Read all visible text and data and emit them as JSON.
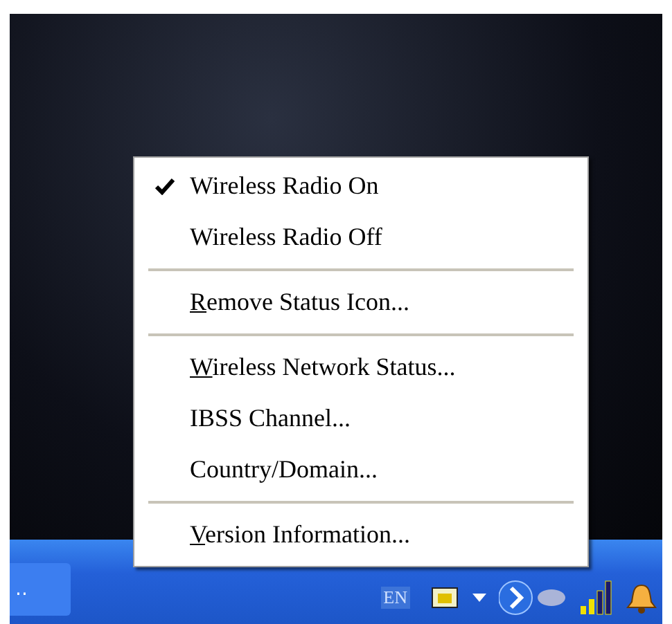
{
  "taskbar": {
    "button_label": "..",
    "language": "EN"
  },
  "menu": {
    "items": [
      {
        "kind": "item",
        "label": "Wireless Radio On",
        "checked": true,
        "underline_first": false
      },
      {
        "kind": "item",
        "label": "Wireless Radio Off",
        "checked": false,
        "underline_first": false
      },
      {
        "kind": "separator"
      },
      {
        "kind": "item",
        "label": "Remove Status Icon...",
        "checked": false,
        "underline_first": true
      },
      {
        "kind": "separator"
      },
      {
        "kind": "item",
        "label": "Wireless Network Status...",
        "checked": false,
        "underline_first": true
      },
      {
        "kind": "item",
        "label": "IBSS Channel...",
        "checked": false,
        "underline_first": false
      },
      {
        "kind": "item",
        "label": "Country/Domain...",
        "checked": false,
        "underline_first": false
      },
      {
        "kind": "separator"
      },
      {
        "kind": "item",
        "label": "Version Information...",
        "checked": false,
        "underline_first": true
      }
    ]
  }
}
